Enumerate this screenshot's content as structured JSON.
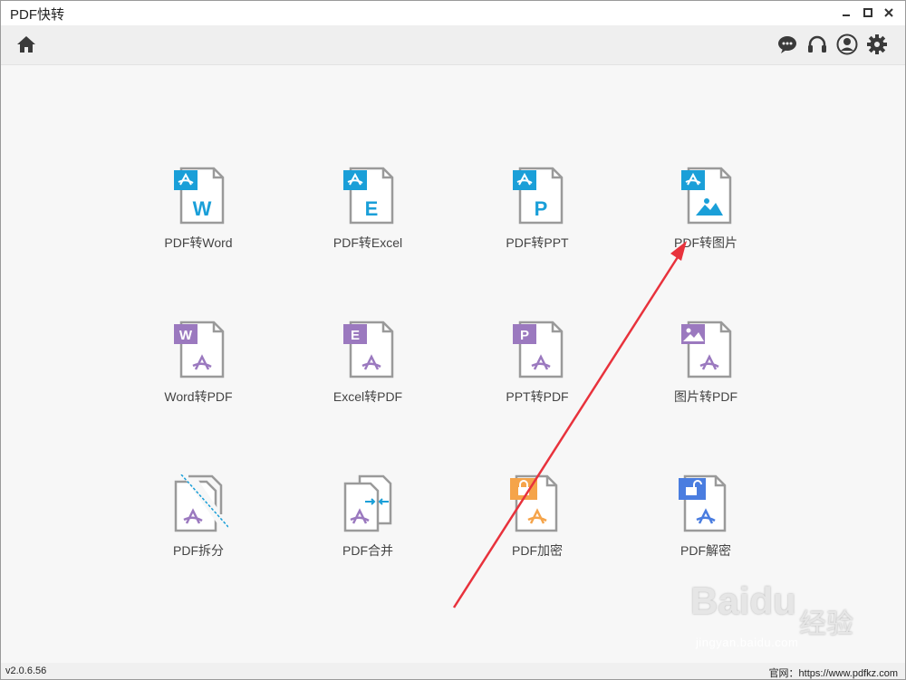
{
  "window": {
    "title": "PDF快转"
  },
  "toolbar": {
    "home_icon": "home-icon",
    "right_icons": [
      "chat-icon",
      "headset-icon",
      "user-icon",
      "settings-icon"
    ]
  },
  "tiles": [
    {
      "label": "PDF转Word",
      "icon": "pdf-to-word-icon",
      "letter": "W"
    },
    {
      "label": "PDF转Excel",
      "icon": "pdf-to-excel-icon",
      "letter": "E"
    },
    {
      "label": "PDF转PPT",
      "icon": "pdf-to-ppt-icon",
      "letter": "P"
    },
    {
      "label": "PDF转图片",
      "icon": "pdf-to-image-icon",
      "letter": ""
    },
    {
      "label": "Word转PDF",
      "icon": "word-to-pdf-icon",
      "letter": "W"
    },
    {
      "label": "Excel转PDF",
      "icon": "excel-to-pdf-icon",
      "letter": "E"
    },
    {
      "label": "PPT转PDF",
      "icon": "ppt-to-pdf-icon",
      "letter": "P"
    },
    {
      "label": "图片转PDF",
      "icon": "image-to-pdf-icon",
      "letter": ""
    },
    {
      "label": "PDF拆分",
      "icon": "pdf-split-icon",
      "letter": ""
    },
    {
      "label": "PDF合并",
      "icon": "pdf-merge-icon",
      "letter": ""
    },
    {
      "label": "PDF加密",
      "icon": "pdf-encrypt-icon",
      "letter": ""
    },
    {
      "label": "PDF解密",
      "icon": "pdf-decrypt-icon",
      "letter": ""
    }
  ],
  "status": {
    "version": "v2.0.6.56",
    "website": "官网：https://www.pdfkz.com"
  },
  "watermark": {
    "logo": "Bai",
    "logo2": "du",
    "sub": "经验",
    "url": "jingyan.baidu.com"
  },
  "colors": {
    "blue": "#1a9fd8",
    "purple": "#9b79bf",
    "orange": "#f5a44a",
    "lock_blue": "#4a7de0",
    "arrow_red": "#e8323c"
  }
}
